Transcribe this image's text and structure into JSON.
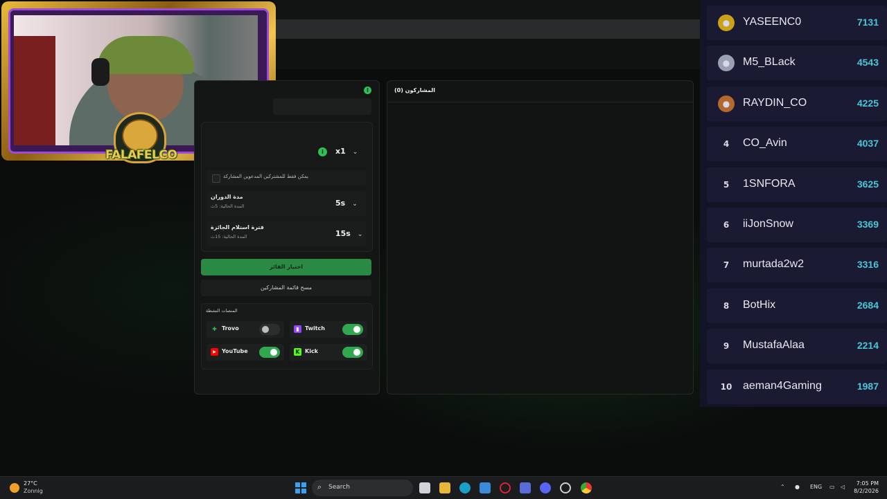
{
  "webcam": {
    "overlay_text": "FALAFELCO"
  },
  "raffle": {
    "multiplier": "x1",
    "subscribers_only_label": "يمكن فقط للمشتركين المدعوين المشاركة",
    "spin_duration": {
      "title": "مدة الدوران",
      "subtitle": "المدة الحالية: 5ث",
      "value": "5s"
    },
    "claim_period": {
      "title": "فترة استلام الجائزة",
      "subtitle": "المدة الحالية: 15ث",
      "value": "15s"
    },
    "pick_winner_label": "اختيار الفائز",
    "clear_list_label": "مسح قائمة المشاركين",
    "platforms_title": "المنصات النشطة",
    "platforms": [
      {
        "name": "Trovo",
        "enabled": false,
        "color": "#2fbf55"
      },
      {
        "name": "Twitch",
        "enabled": true,
        "color": "#9146ff"
      },
      {
        "name": "YouTube",
        "enabled": true,
        "color": "#ff0000"
      },
      {
        "name": "Kick",
        "enabled": true,
        "color": "#53fc18"
      }
    ]
  },
  "participants": {
    "title": "المشاركون (0)"
  },
  "leaderboard": [
    {
      "rank": "",
      "name": "YASEENC0",
      "score": "7131"
    },
    {
      "rank": "",
      "name": "M5_BLack",
      "score": "4543"
    },
    {
      "rank": "",
      "name": "RAYDIN_CO",
      "score": "4225"
    },
    {
      "rank": "4",
      "name": "CO_Avin",
      "score": "4037"
    },
    {
      "rank": "5",
      "name": "1SNFORA",
      "score": "3625"
    },
    {
      "rank": "6",
      "name": "iiJonSnow",
      "score": "3369"
    },
    {
      "rank": "7",
      "name": "murtada2w2",
      "score": "3316"
    },
    {
      "rank": "8",
      "name": "BotHix",
      "score": "2684"
    },
    {
      "rank": "9",
      "name": "MustafaAlaa",
      "score": "2214"
    },
    {
      "rank": "10",
      "name": "aeman4Gaming",
      "score": "1987"
    }
  ],
  "taskbar": {
    "weather_temp": "27°C",
    "weather_desc": "Zonnig",
    "search_label": "Search",
    "language": "ENG",
    "time": "7:05 PM",
    "date": "8/2/2026"
  }
}
